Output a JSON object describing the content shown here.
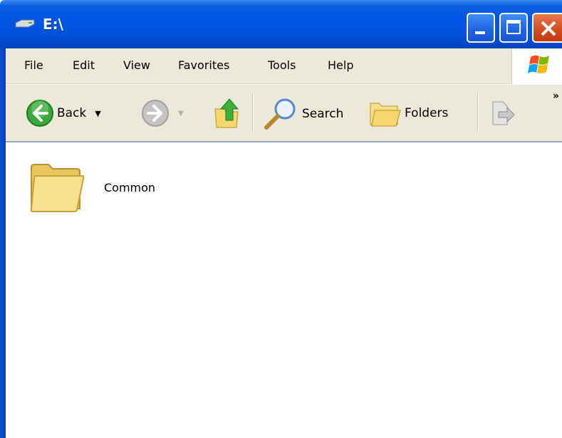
{
  "window": {
    "title": "E:\\"
  },
  "menu": {
    "file": "File",
    "edit": "Edit",
    "view": "View",
    "favorites": "Favorites",
    "tools": "Tools",
    "help": "Help"
  },
  "toolbar": {
    "back": "Back",
    "search": "Search",
    "folders": "Folders",
    "more": "»"
  },
  "files": [
    {
      "name": "Common",
      "icon": "folder-icon"
    }
  ],
  "colors": {
    "titlebar": "#0055e5",
    "chrome": "#ece9d8",
    "close": "#d34a1e"
  }
}
